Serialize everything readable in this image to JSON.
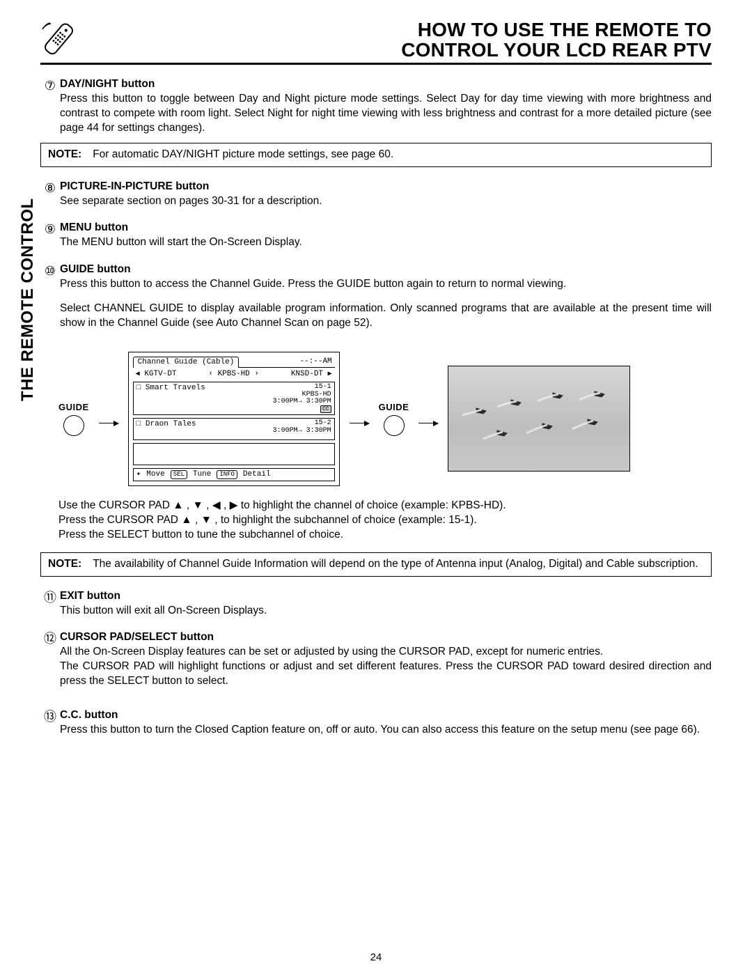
{
  "header": {
    "title_line1": "HOW TO USE THE REMOTE TO",
    "title_line2": "CONTROL YOUR LCD REAR PTV"
  },
  "sidebar_label": "THE REMOTE CONTROL",
  "page_number": "24",
  "items": {
    "n7": {
      "num": "⑦",
      "title": "DAY/NIGHT button",
      "text": "Press this button to toggle between Day and Night picture mode settings.  Select Day for day time viewing with more brightness and contrast to compete with room light.  Select Night for night time viewing with less brightness and contrast for a more detailed picture (see page 44 for settings changes)."
    },
    "n8": {
      "num": "⑧",
      "title": "PICTURE-IN-PICTURE button",
      "text": "See separate section on pages 30-31 for a description."
    },
    "n9": {
      "num": "⑨",
      "title": "MENU button",
      "text": "The MENU button will start the On-Screen Display."
    },
    "n10": {
      "num": "⑩",
      "title": "GUIDE button",
      "text1": "Press this button to access the Channel Guide.  Press the GUIDE button again to return to normal viewing.",
      "text2": "Select CHANNEL GUIDE to display available program information.  Only scanned programs that are available at the present time will show in the Channel Guide (see Auto Channel Scan on page 52)."
    },
    "n11": {
      "num": "⑪",
      "title": "EXIT button",
      "text": "This button will exit all On-Screen Displays."
    },
    "n12": {
      "num": "⑫",
      "title": "CURSOR PAD/SELECT button",
      "text": "All the On-Screen Display features can be set or adjusted by using the CURSOR PAD, except for numeric entries.\nThe CURSOR PAD will highlight functions or adjust and set different features.  Press the CURSOR PAD toward desired direction and press the SELECT button to select."
    },
    "n13": {
      "num": "⑬",
      "title": "C.C. button",
      "text": "Press this button to turn the Closed Caption feature on, off or auto.  You can also access this feature on the setup menu (see page 66)."
    }
  },
  "note1": {
    "label": "NOTE:",
    "text": "For automatic DAY/NIGHT picture mode settings, see page 60."
  },
  "note2": {
    "label": "NOTE:",
    "text": "The availability of Channel Guide Information will depend on the type of Antenna input (Analog, Digital) and Cable subscription."
  },
  "diagram": {
    "guide_label": "GUIDE",
    "cg": {
      "title": "Channel Guide (Cable)",
      "time": "--:--AM",
      "ch_left": "KGTV-DT",
      "ch_mid": "KPBS-HD",
      "ch_right": "KNSD-DT",
      "tri_l": "◀",
      "tri_r": "▶",
      "lguil": "‹",
      "rguil": "›",
      "row1": {
        "name": "□ Smart Travels",
        "sub": "15-1",
        "station": "KPBS-HD",
        "start": "3:00PM",
        "end": "3:30PM",
        "cc": "CC"
      },
      "row2": {
        "name": "□ Draon Tales",
        "sub": "15-2",
        "start": "3:00PM",
        "end": "3:30PM"
      },
      "footer": {
        "move_icon": "✦",
        "move": "Move",
        "sel_badge": "SEL",
        "tune": "Tune",
        "info_badge": "INFO",
        "detail": "Detail"
      }
    }
  },
  "below": {
    "l1a": "Use the CURSOR PAD ",
    "l1b": " to highlight the channel of choice (example: KPBS-HD).",
    "l2a": "Press  the CURSOR PAD ",
    "l2b": " , to highlight the subchannel of choice (example: 15-1).",
    "l3": "Press the SELECT button to tune the subchannel of choice.",
    "up": "▲",
    "down": "▼",
    "left": "◀",
    "right": "▶",
    "comma": " , "
  }
}
